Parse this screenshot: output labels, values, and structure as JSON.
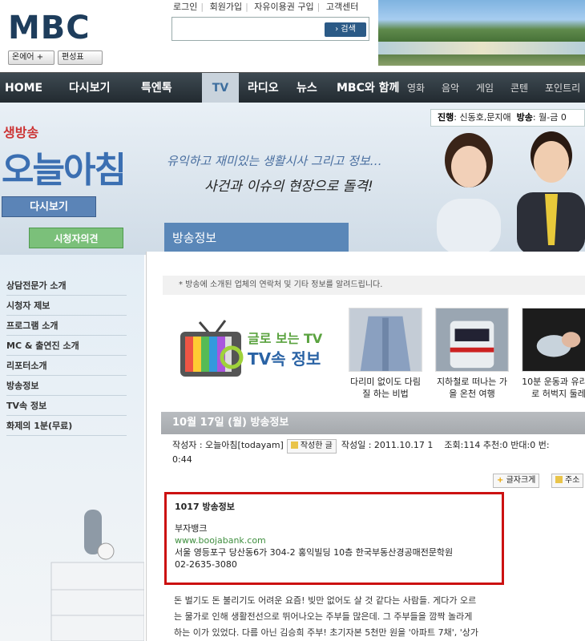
{
  "top": {
    "logo": "MBC",
    "links": [
      "로그인",
      "회원가입",
      "자유이용권 구입",
      "고객센터"
    ],
    "search_button": "검색",
    "search_placeholder": "",
    "on_air": "온에어 +",
    "schedule": "편성표"
  },
  "nav": {
    "items": [
      "HOME",
      "다시보기",
      "특엔톡",
      "TV",
      "라디오",
      "뉴스",
      "MBC와 함께",
      "영화",
      "음악",
      "게임",
      "콘텐",
      "포인트리"
    ]
  },
  "hero": {
    "info_label_1": "진행",
    "info_value_1": ": 신동호,문지애",
    "info_label_2": "방송",
    "info_value_2": ": 월-금 0",
    "slogan1": "유익하고 재미있는 생활시사 그리고 정보…",
    "slogan2": "사건과 이슈의 현장으로 돌격!",
    "live": "생방송",
    "program_title": "오늘아침",
    "btn_replay": "다시보기",
    "btn_opinion": "시청자의견",
    "tab_title": "방송정보"
  },
  "sidebar": {
    "items": [
      "상담전문가 소개",
      "시청자 제보",
      "프로그램 소개",
      "MC & 출연진 소개",
      "리포터소개",
      "방송정보",
      "TV속 정보",
      "화제의 1분(무료)"
    ]
  },
  "content": {
    "notice": "* 방송에 소개된 업체의 연락처 및 기타 정보를 알려드립니다.",
    "tv_logo_line1": "글로 보는 TV",
    "tv_logo_line2": "TV속 정보",
    "thumbs": [
      {
        "caption": "다리미 없이도 다림질 하는 비법"
      },
      {
        "caption": "지하철로 떠나는 가을 온천 여행"
      },
      {
        "caption": "10분 운동과 유리으로 허벅지 둘레"
      }
    ],
    "date_title": "10월 17일 (월) 방송정보",
    "author_label": "작성자 : 오늘아침[todayam]",
    "author_btn": "작성한 글",
    "date_label": "작성일 : 2011.10.17 1",
    "stats": "조회:114 추천:0 반대:0 번:",
    "time_cont": "0:44",
    "fontsize_btn": "글자크게",
    "addr_btn": "주소",
    "box": {
      "heading": "1017 방송정보",
      "name": "부자뱅크",
      "url": "www.boojabank.com",
      "address": "서울 영등포구 당산동6가 304-2 홍익빌딩 10층 한국부동산경공매전문학원",
      "phone": "02-2635-3080"
    },
    "body": [
      "돈 벌기도 돈 불리기도 어려운 요즘! 빚만 없어도 살 것 같다는 사람들. 게다가 오르",
      "는 물가로 인해 생활전선으로 뛰어나오는 주부들 많은데. 그 주부들을 깜짝 놀라게",
      "하는 이가 있었다. 다름 아닌 김승희 주부! 초기자본 5천만 원을 '아파트 7채', '상가"
    ]
  }
}
